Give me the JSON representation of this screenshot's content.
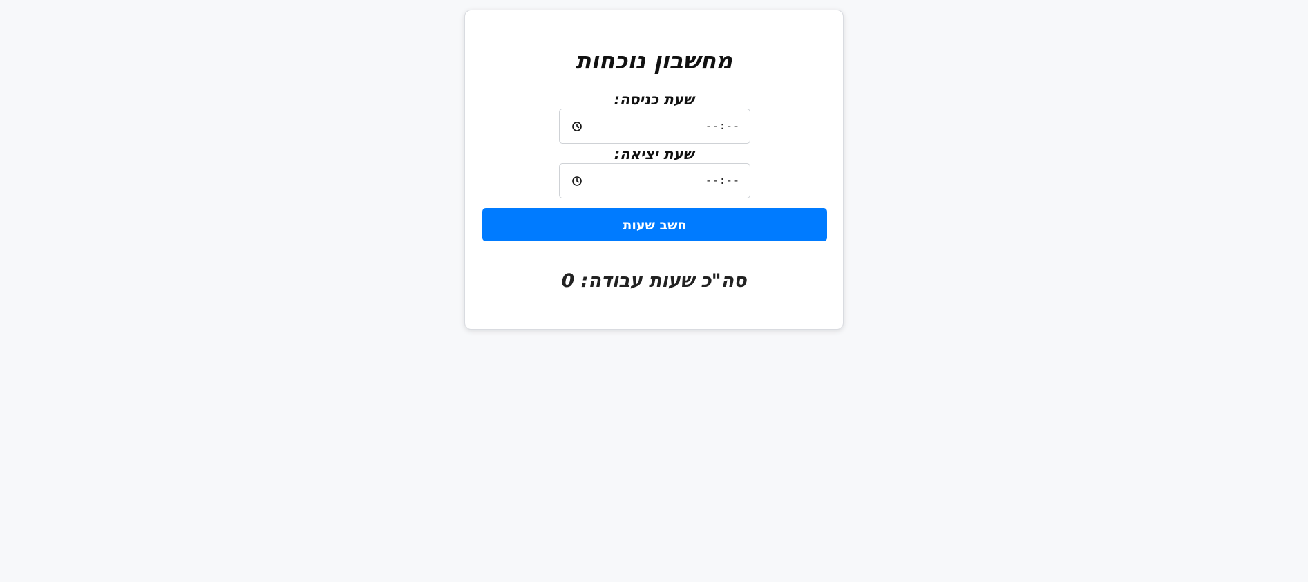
{
  "calculator": {
    "title": "מחשבון נוכחות",
    "entry_label": "שעת כניסה:",
    "entry_value": "--:--",
    "exit_label": "שעת יציאה:",
    "exit_value": "--:--",
    "button_label": "חשב שעות",
    "result_text": "סה\"כ שעות עבודה: 0"
  },
  "colors": {
    "background": "#f7f8fa",
    "card": "#ffffff",
    "button": "#007bff",
    "button_text": "#ffffff"
  },
  "icons": {
    "time_picker": "clock-icon"
  }
}
